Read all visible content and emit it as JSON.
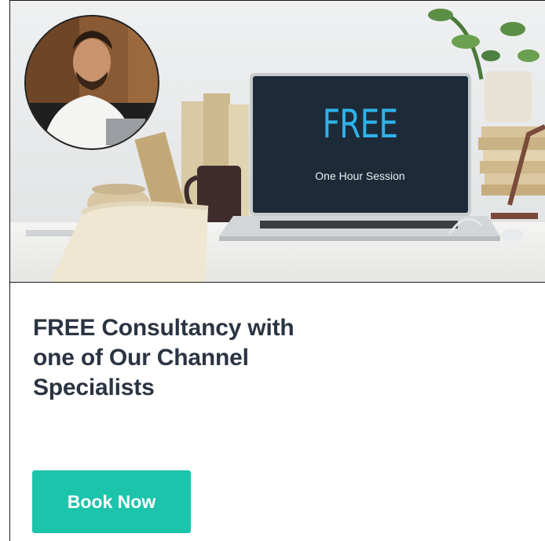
{
  "hero": {
    "screen_headline": "FREE",
    "screen_subline": "One Hour Session",
    "avatar_icon": "person-photo-icon"
  },
  "content": {
    "headline_lines": [
      "FREE Consultancy with",
      "one of Our Channel",
      "Specialists"
    ]
  },
  "cta": {
    "label": "Book Now"
  },
  "colors": {
    "accent": "#1cc4ab",
    "headline": "#2b3442",
    "screen_text": "#2fb3ea",
    "screen_bg": "#1d2b38"
  }
}
